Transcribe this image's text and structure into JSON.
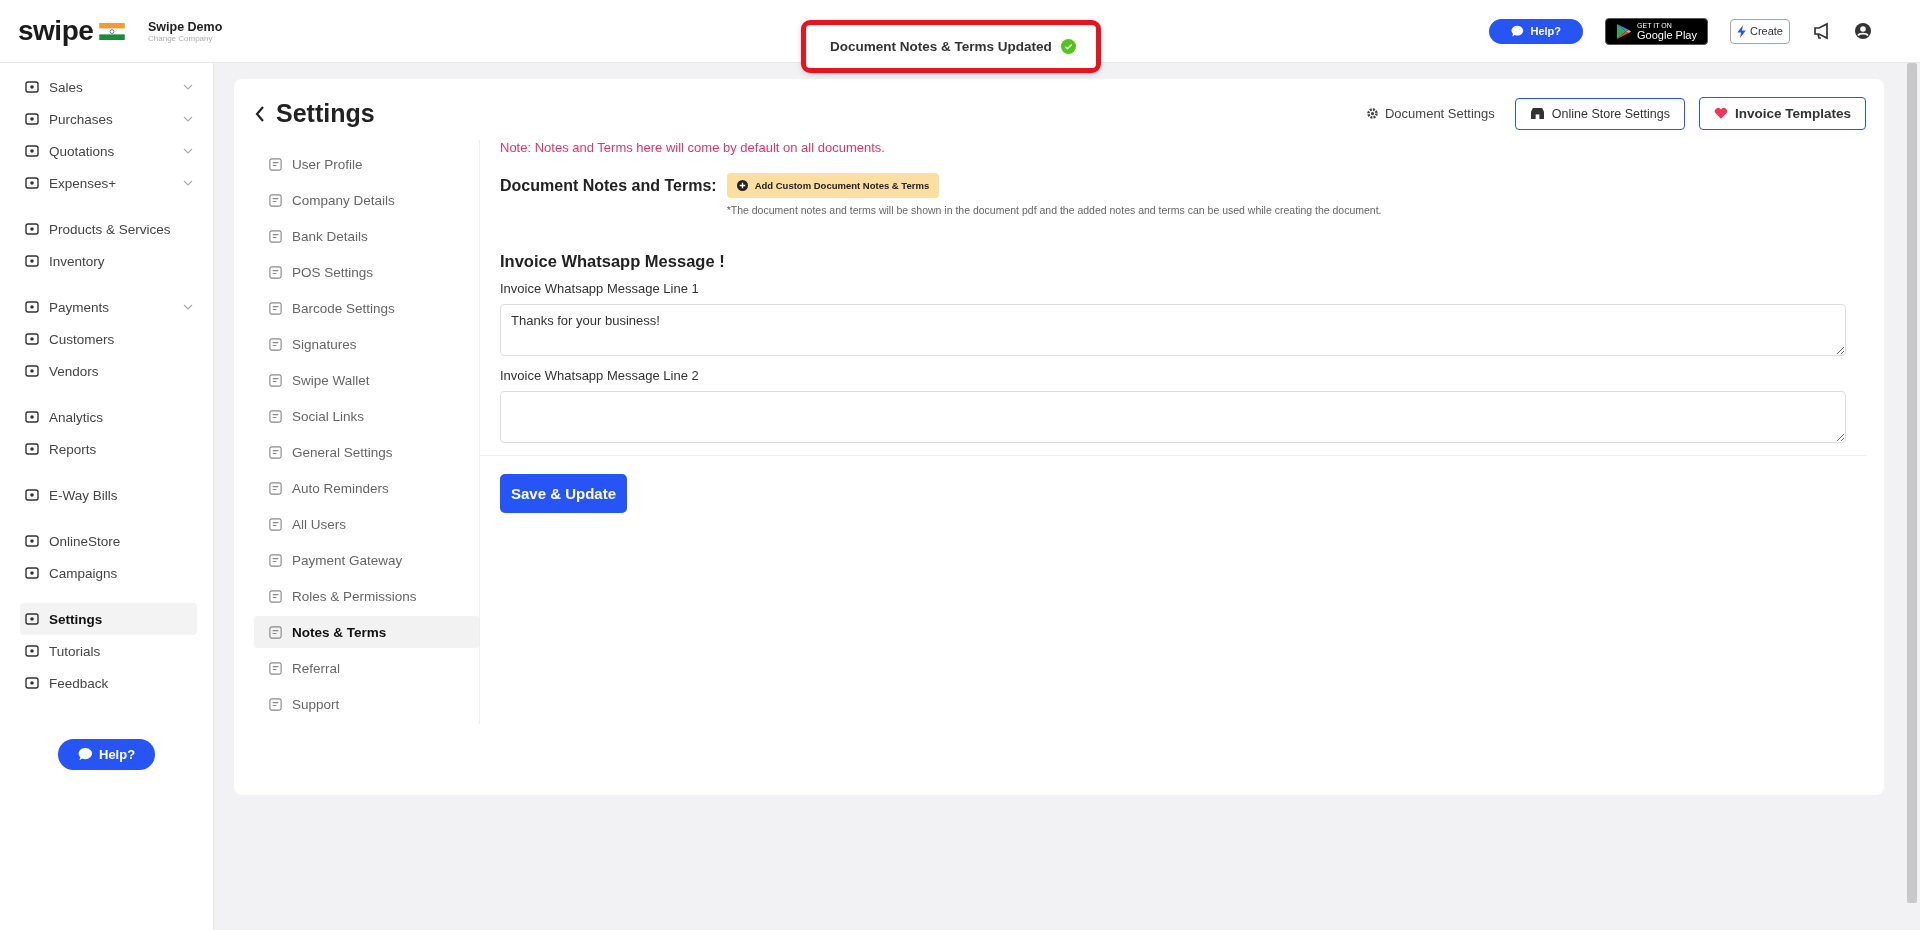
{
  "header": {
    "logo": "swipe",
    "company": "Swipe Demo",
    "change_company": "Change Company",
    "help": "Help?",
    "play_badge": {
      "small": "GET IT ON",
      "big": "Google Play"
    },
    "create": "Create"
  },
  "toast": {
    "text": "Document Notes & Terms Updated",
    "highlighted": true
  },
  "sidebar": {
    "groups": [
      [
        {
          "label": "Sales",
          "dropdown": true,
          "selected": false
        },
        {
          "label": "Purchases",
          "dropdown": true,
          "selected": false
        },
        {
          "label": "Quotations",
          "dropdown": true,
          "selected": false
        },
        {
          "label": "Expenses+",
          "dropdown": true,
          "selected": false
        }
      ],
      [
        {
          "label": "Products & Services",
          "dropdown": false,
          "selected": false
        },
        {
          "label": "Inventory",
          "dropdown": false,
          "selected": false
        }
      ],
      [
        {
          "label": "Payments",
          "dropdown": true,
          "selected": false
        },
        {
          "label": "Customers",
          "dropdown": false,
          "selected": false
        },
        {
          "label": "Vendors",
          "dropdown": false,
          "selected": false
        }
      ],
      [
        {
          "label": "Analytics",
          "dropdown": false,
          "selected": false
        },
        {
          "label": "Reports",
          "dropdown": false,
          "selected": false
        }
      ],
      [
        {
          "label": "E-Way Bills",
          "dropdown": false,
          "selected": false
        }
      ],
      [
        {
          "label": "OnlineStore",
          "dropdown": false,
          "selected": false
        },
        {
          "label": "Campaigns",
          "dropdown": false,
          "selected": false
        }
      ],
      [
        {
          "label": "Settings",
          "dropdown": false,
          "selected": true
        },
        {
          "label": "Tutorials",
          "dropdown": false,
          "selected": false
        },
        {
          "label": "Feedback",
          "dropdown": false,
          "selected": false
        }
      ]
    ],
    "help": "Help?"
  },
  "page": {
    "title": "Settings",
    "actions": {
      "document_settings": "Document Settings",
      "online_store": "Online Store Settings",
      "invoice_templates": "Invoice Templates"
    }
  },
  "settings_nav": [
    {
      "label": "User Profile",
      "selected": false
    },
    {
      "label": "Company Details",
      "selected": false
    },
    {
      "label": "Bank Details",
      "selected": false
    },
    {
      "label": "POS Settings",
      "selected": false
    },
    {
      "label": "Barcode Settings",
      "selected": false
    },
    {
      "label": "Signatures",
      "selected": false
    },
    {
      "label": "Swipe Wallet",
      "selected": false
    },
    {
      "label": "Social Links",
      "selected": false
    },
    {
      "label": "General Settings",
      "selected": false
    },
    {
      "label": "Auto Reminders",
      "selected": false
    },
    {
      "label": "All Users",
      "selected": false
    },
    {
      "label": "Payment Gateway",
      "selected": false
    },
    {
      "label": "Roles & Permissions",
      "selected": false
    },
    {
      "label": "Notes & Terms",
      "selected": true
    },
    {
      "label": "Referral",
      "selected": false
    },
    {
      "label": "Support",
      "selected": false
    }
  ],
  "content": {
    "note": "Note: Notes and Terms here will come by default on all documents.",
    "notes_heading": "Document Notes and Terms:",
    "add_button": "Add Custom Document Notes & Terms",
    "hint": "*The document notes and terms will be shown in the document pdf and the added notes and terms can be used while creating the document.",
    "whatsapp_heading": "Invoice Whatsapp Message !",
    "fields": [
      {
        "label": "Invoice Whatsapp Message Line 1",
        "value": "Thanks for your business!"
      },
      {
        "label": "Invoice Whatsapp Message Line 2"
      }
    ],
    "save": "Save & Update"
  }
}
